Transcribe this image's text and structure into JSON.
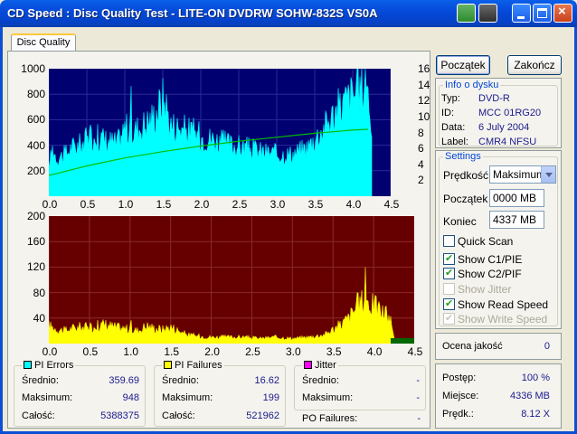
{
  "window": {
    "title": "CD Speed : Disc Quality Test - LITE-ON DVDRW SOHW-832S  VS0A"
  },
  "tabs": [
    {
      "label": "Disc Quality"
    }
  ],
  "buttons": {
    "start": "Początek",
    "end": "Zakończ"
  },
  "disc_info": {
    "title": "Info o dysku",
    "rows": [
      {
        "label": "Typ:",
        "value": "DVD-R"
      },
      {
        "label": "ID:",
        "value": "MCC 01RG20"
      },
      {
        "label": "Data:",
        "value": "6 July 2004"
      },
      {
        "label": "Label:",
        "value": "CMR4  NFSU"
      }
    ]
  },
  "settings": {
    "title": "Settings",
    "speed_label": "Prędkość",
    "speed_value": "Maksimum",
    "start_label": "Początek",
    "start_value": "0000 MB",
    "end_label": "Koniec",
    "end_value": "4337 MB",
    "checkboxes": [
      {
        "label": "Quick Scan",
        "checked": false,
        "disabled": false
      },
      {
        "label": "Show C1/PIE",
        "checked": true,
        "disabled": false
      },
      {
        "label": "Show C2/PIF",
        "checked": true,
        "disabled": false
      },
      {
        "label": "Show Jitter",
        "checked": false,
        "disabled": true
      },
      {
        "label": "Show Read Speed",
        "checked": true,
        "disabled": false
      },
      {
        "label": "Show Write Speed",
        "checked": true,
        "disabled": true
      }
    ]
  },
  "quality": {
    "label": "Ocena jakość",
    "value": "0"
  },
  "progress": {
    "rows": [
      {
        "label": "Postęp:",
        "value": "100 %"
      },
      {
        "label": "Miejsce:",
        "value": "4336 MB"
      },
      {
        "label": "Prędk.:",
        "value": "8.12 X"
      }
    ]
  },
  "stats": {
    "pi_errors": {
      "title": "PI Errors",
      "color": "#00FFFF",
      "rows": [
        {
          "label": "Średnio:",
          "value": "359.69"
        },
        {
          "label": "Maksimum:",
          "value": "948"
        },
        {
          "label": "Całość:",
          "value": "5388375"
        }
      ]
    },
    "pi_failures": {
      "title": "PI Failures",
      "color": "#FFFF00",
      "rows": [
        {
          "label": "Średnio:",
          "value": "16.62"
        },
        {
          "label": "Maksimum:",
          "value": "199"
        },
        {
          "label": "Całość:",
          "value": "521962"
        }
      ]
    },
    "jitter": {
      "title": "Jitter",
      "color": "#FF00FF",
      "rows": [
        {
          "label": "Średnio:",
          "value": "-"
        },
        {
          "label": "Maksimum:",
          "value": "-"
        }
      ],
      "po_label": "PO Failures:",
      "po_value": "-"
    }
  },
  "chart_data": [
    {
      "type": "area",
      "series": [
        {
          "name": "PI Errors",
          "color": "#00FFFF",
          "x": [
            0,
            0.05,
            0.1,
            0.2,
            0.3,
            0.4,
            0.5,
            0.6,
            0.7,
            0.8,
            0.9,
            1.0,
            1.1,
            1.2,
            1.3,
            1.4,
            1.5,
            1.55,
            1.6,
            1.7,
            1.8,
            1.9,
            2.0,
            2.2,
            2.4,
            2.6,
            2.8,
            3.0,
            3.2,
            3.4,
            3.5,
            3.6,
            3.7,
            3.8,
            3.9,
            4.0,
            4.1,
            4.2,
            4.25
          ],
          "y": [
            230,
            380,
            300,
            320,
            380,
            400,
            440,
            470,
            450,
            430,
            410,
            540,
            500,
            540,
            580,
            640,
            770,
            700,
            560,
            540,
            520,
            500,
            470,
            440,
            400,
            380,
            350,
            330,
            330,
            380,
            450,
            520,
            600,
            680,
            740,
            800,
            840,
            870,
            560
          ]
        },
        {
          "name": "Read Speed",
          "color": "#00C000",
          "axis": "right",
          "x": [
            0,
            0.5,
            1.0,
            1.5,
            2.0,
            2.5,
            3.0,
            3.5,
            4.0,
            4.2
          ],
          "y": [
            2.6,
            3.8,
            4.8,
            5.6,
            6.3,
            6.9,
            7.4,
            7.9,
            8.3,
            8.4
          ]
        }
      ],
      "xlim": [
        0,
        4.5
      ],
      "ylim": [
        0,
        1000
      ],
      "y2lim": [
        0,
        16
      ],
      "x_ticks": [
        "0.0",
        "0.5",
        "1.0",
        "1.5",
        "2.0",
        "2.5",
        "3.0",
        "3.5",
        "4.0",
        "4.5"
      ],
      "y_ticks": [
        "1000",
        "800",
        "600",
        "400",
        "200"
      ],
      "y2_ticks": [
        "16",
        "14",
        "12",
        "10",
        "8",
        "6",
        "4",
        "2"
      ]
    },
    {
      "type": "area",
      "series": [
        {
          "name": "PI Failures",
          "color": "#FFFF00",
          "x": [
            0,
            0.1,
            0.2,
            0.3,
            0.4,
            0.5,
            0.6,
            0.7,
            0.8,
            0.9,
            1.0,
            1.1,
            1.2,
            1.3,
            1.4,
            1.5,
            1.6,
            1.7,
            1.8,
            2.0,
            2.2,
            2.4,
            2.6,
            2.8,
            3.0,
            3.2,
            3.4,
            3.5,
            3.6,
            3.7,
            3.8,
            3.9,
            4.0,
            4.1,
            4.2,
            4.25
          ],
          "y": [
            28,
            22,
            20,
            24,
            26,
            24,
            28,
            30,
            26,
            24,
            22,
            20,
            28,
            24,
            22,
            26,
            20,
            14,
            12,
            10,
            10,
            10,
            8,
            10,
            8,
            10,
            14,
            22,
            30,
            40,
            60,
            70,
            60,
            50,
            40,
            10
          ]
        }
      ],
      "xlim": [
        0,
        4.5
      ],
      "ylim": [
        0,
        200
      ],
      "x_ticks": [
        "0.0",
        "0.5",
        "1.0",
        "1.5",
        "2.0",
        "2.5",
        "3.0",
        "3.5",
        "4.0",
        "4.5"
      ],
      "y_ticks": [
        "200",
        "160",
        "120",
        "80",
        "40"
      ]
    }
  ]
}
